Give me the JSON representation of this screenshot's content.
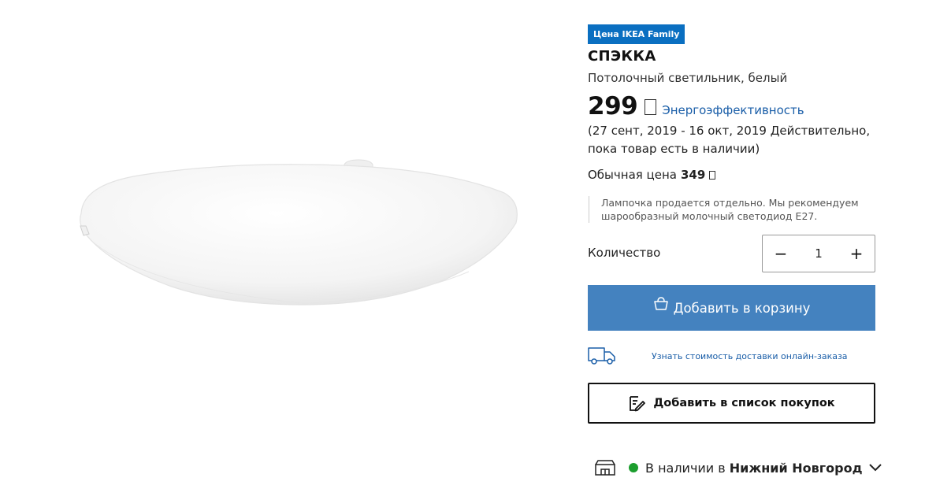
{
  "product": {
    "badge": "Цена IKEA Family",
    "name": "СПЭККА",
    "description": "Потолочный светильник, белый"
  },
  "price": {
    "value": "299",
    "energy_link": "Энергоэффективность",
    "validity": "(27 сент, 2019 - 16 окт, 2019 Действительно, пока товар есть в наличии)",
    "regular_label": "Обычная цена",
    "regular_value": "349"
  },
  "notice": "Лампочка продается отдельно. Мы рекомендуем шарообразный молочный светодиод E27.",
  "quantity": {
    "label": "Количество",
    "value": "1",
    "minus": "−",
    "plus": "+"
  },
  "actions": {
    "add_to_cart": "Добавить в корзину",
    "delivery_link": "Узнать стоимость доставки онлайн-заказа",
    "add_to_list": "Добавить в список покупок"
  },
  "stock": {
    "text": "В наличии в",
    "city": "Нижний Новгород",
    "status_color": "#1c9e2e"
  },
  "icons": {
    "currency": "currency-placeholder-icon",
    "bag": "shopping-bag-icon",
    "truck": "delivery-truck-icon",
    "list": "shopping-list-edit-icon",
    "store": "store-icon",
    "chevron": "chevron-down-icon"
  },
  "colors": {
    "badge": "#0a6fc1",
    "primary_button": "#4482bf",
    "link": "#1a5ea8"
  }
}
